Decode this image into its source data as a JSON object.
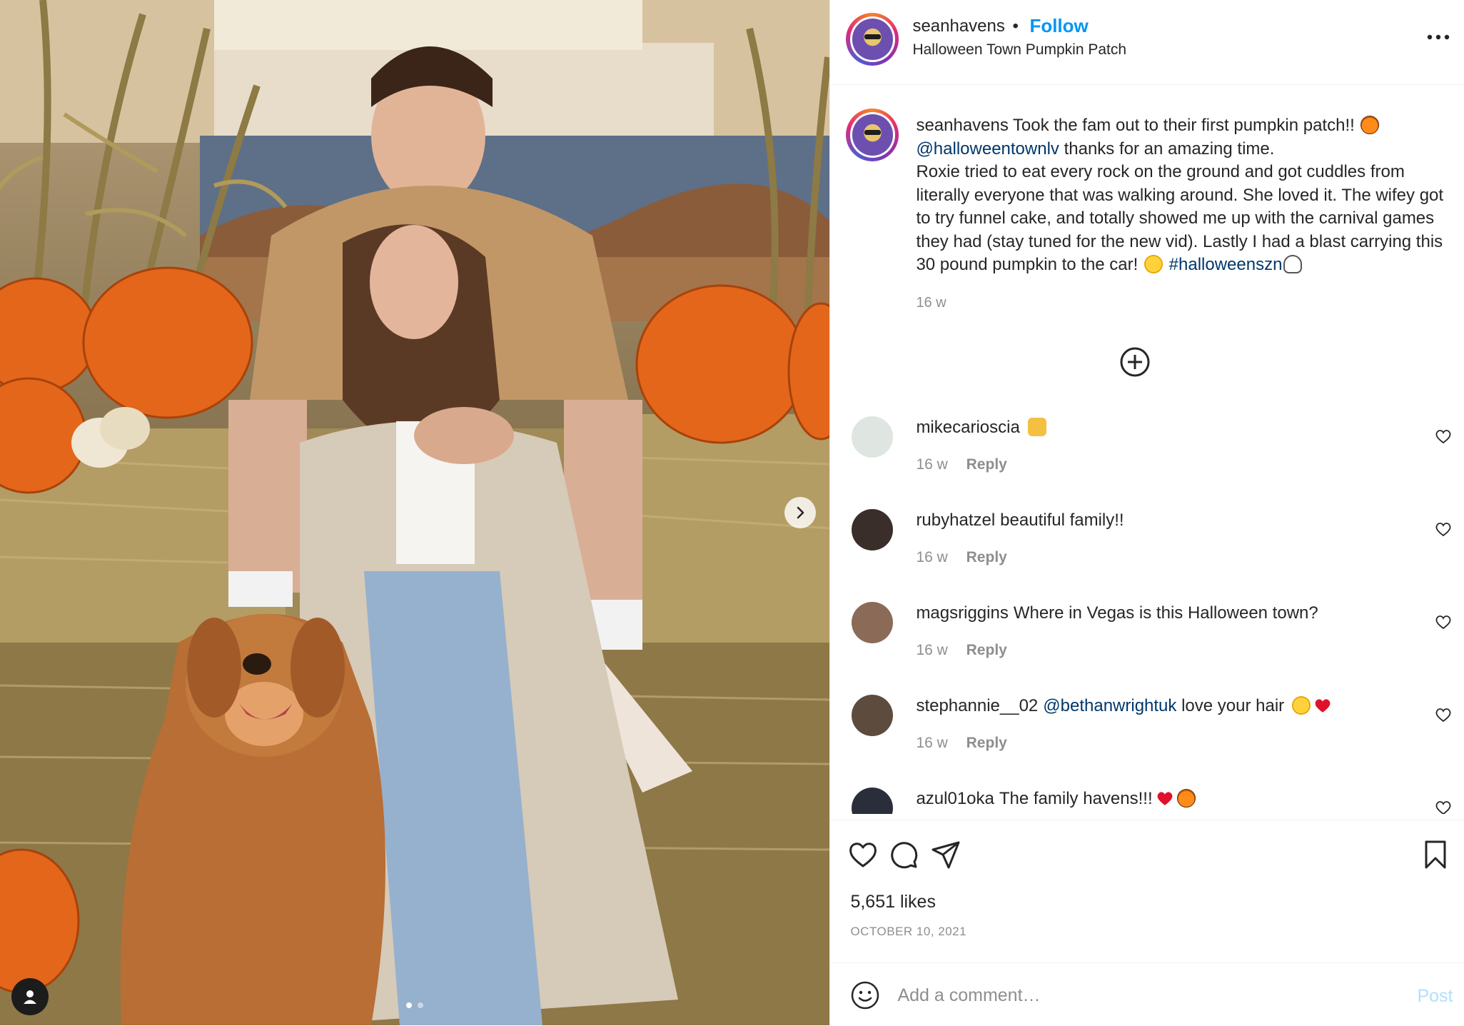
{
  "post": {
    "username": "seanhavens",
    "separator": "•",
    "follow_label": "Follow",
    "location": "Halloween Town Pumpkin Patch",
    "more_icon": "more-options-icon"
  },
  "caption": {
    "username": "seanhavens",
    "text_1": "Took the fam out to their first pumpkin patch!!",
    "mention": "@halloweentownlv",
    "text_2": "thanks for an amazing time.",
    "text_3": "Roxie tried to eat every rock on the ground and got cuddles from literally everyone that was walking around. She loved it. The wifey got to try funnel cake, and totally showed me up with the carnival games they had (stay tuned for the new vid). Lastly I had a blast carrying this 30 pound pumpkin to the car!",
    "hashtag": "#halloweenszn",
    "time": "16 w"
  },
  "comments": [
    {
      "username": "mikecarioscia",
      "text": "",
      "mention": "",
      "time": "16 w",
      "reply": "Reply",
      "avatar_color": "#dfe6e2"
    },
    {
      "username": "rubyhatzel",
      "text": "beautiful family!!",
      "mention": "",
      "time": "16 w",
      "reply": "Reply",
      "avatar_color": "#3a2e2a"
    },
    {
      "username": "magsriggins",
      "text": "Where in Vegas is this Halloween town?",
      "mention": "",
      "time": "16 w",
      "reply": "Reply",
      "avatar_color": "#8b6a58"
    },
    {
      "username": "stephannie__02",
      "text": "love your hair",
      "mention": "@bethanwrightuk",
      "time": "16 w",
      "reply": "Reply",
      "avatar_color": "#5d4b3e"
    },
    {
      "username": "azul01oka",
      "text": "The family havens!!!",
      "mention": "",
      "time": "",
      "reply": "",
      "avatar_color": "#2a2d3a"
    }
  ],
  "actions": {
    "likes": "5,651 likes",
    "date": "OCTOBER 10, 2021"
  },
  "add_comment": {
    "placeholder": "Add a comment…",
    "post_label": "Post"
  },
  "colors": {
    "accent": "#0095f6",
    "link": "#00376b",
    "muted": "#8e8e8e",
    "post_disabled": "#b2dffc"
  }
}
